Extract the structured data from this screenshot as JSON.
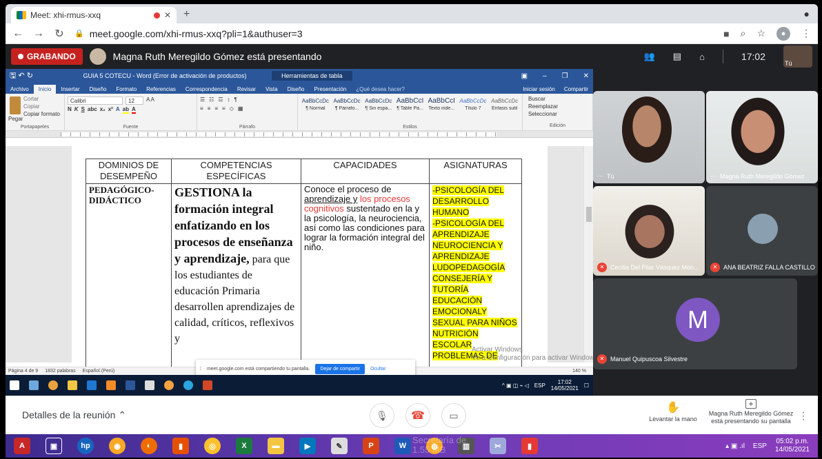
{
  "browser": {
    "tab_title": "Meet: xhi-rmus-xxq",
    "url": "meet.google.com/xhi-rmus-xxq?pli=1&authuser=3"
  },
  "meet_header": {
    "recording_label": "GRABANDO",
    "presenting_text": "Magna Ruth Meregildo Gómez está presentando",
    "clock": "17:02",
    "self_label": "Tú"
  },
  "word": {
    "title": "GUIA 5 COTECU - Word (Error de activación de productos)",
    "tools_context": "Herramientas de tabla",
    "tabs": [
      "Archivo",
      "Inicio",
      "Insertar",
      "Diseño",
      "Formato",
      "Referencias",
      "Correspondencia",
      "Revisar",
      "Vista",
      "Diseño",
      "Presentación"
    ],
    "tell_me": "¿Qué desea hacer?",
    "signin": "Iniciar sesión",
    "share": "Compartir",
    "clipboard": {
      "cut": "Cortar",
      "copy": "Copiar",
      "paste": "Pegar",
      "format": "Copiar formato",
      "group": "Portapapeles"
    },
    "font": {
      "name": "Calibri",
      "size": "12",
      "group": "Fuente"
    },
    "paragraph_group": "Párrafo",
    "styles": [
      {
        "sample": "AaBbCcDc",
        "name": "¶ Normal"
      },
      {
        "sample": "AaBbCcDc",
        "name": "¶ Párrafo..."
      },
      {
        "sample": "AaBbCcDc",
        "name": "¶ Sin espa..."
      },
      {
        "sample": "AaBbCcI",
        "name": "¶ Table Pa..."
      },
      {
        "sample": "AaBbCcI",
        "name": "Texto inde..."
      },
      {
        "sample": "AaBbCcDc",
        "name": "Título 7"
      },
      {
        "sample": "AaBbCcDc",
        "name": "Énfasis sutil"
      }
    ],
    "styles_group": "Estilos",
    "edit": {
      "find": "Buscar",
      "replace": "Reemplazar",
      "select": "Seleccionar",
      "group": "Edición"
    },
    "status": {
      "page": "Página 4 de 9",
      "words": "1832 palabras",
      "lang": "Español (Perú)",
      "zoom": "140 %"
    },
    "table": {
      "headers": [
        "DOMINIOS DE DESEMPEÑO",
        "COMPETENCIAS ESPECÍFICAS",
        "CAPACIDADES",
        "ASIGNATURAS"
      ],
      "col1": "PEDAGÓGICO-DIDÁCTICO",
      "col2_bold": "GESTIONA la formación integral enfatizando en los procesos de enseñanza y aprendizaje,",
      "col2_rest": " para que los estudiantes de educación Primaria desarrollen aprendizajes de calidad, críticos, reflexivos y",
      "col3_a": "Conoce el proceso de ",
      "col3_ul": "aprendizaje y",
      "col3_red": " los procesos cognitivos",
      "col3_b": " sustentado en la y la psicología, la neurociencia, así como las condiciones para lograr la formación integral del niño.",
      "col4": [
        "-PSICOLOGÍA DEL DESARROLLO HUMANO",
        "-PSICOLOGÍA DEL APRENDIZAJE",
        "NEUROCIENCIA Y APRENDIZAJE",
        "LUDOPEDAGOGÍA",
        "CONSEJERÍA Y TUTORÍA",
        "EDUCACIÓN EMOCIONALY SEXUAL PARA NIÑOS",
        "NUTRICIÓN ESCOLAR",
        "PROBLEMAS DE"
      ]
    },
    "watermark": "Activar Windows\nVe a Configuración para activar Windows."
  },
  "sharebar": {
    "text": "meet.google.com está compartiendo tu pantalla.",
    "stop": "Dejar de compartir",
    "hide": "Ocultar"
  },
  "inner_tray": {
    "lang": "ESP",
    "time": "17:02",
    "date": "14/05/2021"
  },
  "participants": [
    {
      "name": "Tú"
    },
    {
      "name": "Magna Ruth Meregildo Gómez"
    },
    {
      "name": "Cecilia Del Pilar Vásquez Mon..."
    },
    {
      "name": "ANA BEATRIZ FALLA CASTILLO"
    },
    {
      "name": "Manuel Quipuscoa Silvestre",
      "initial": "M"
    }
  ],
  "meet_bottom": {
    "details": "Detalles de la reunión",
    "raise_hand": "Levantar la mano",
    "presenting": "Magna Ruth Meregildo Gómez está presentando su pantalla"
  },
  "outer_tray": {
    "lang": "ESP",
    "time": "05:02 p.m.",
    "date": "14/05/2021"
  },
  "outer_ghost": "Secretaría de\n1.55 MB"
}
